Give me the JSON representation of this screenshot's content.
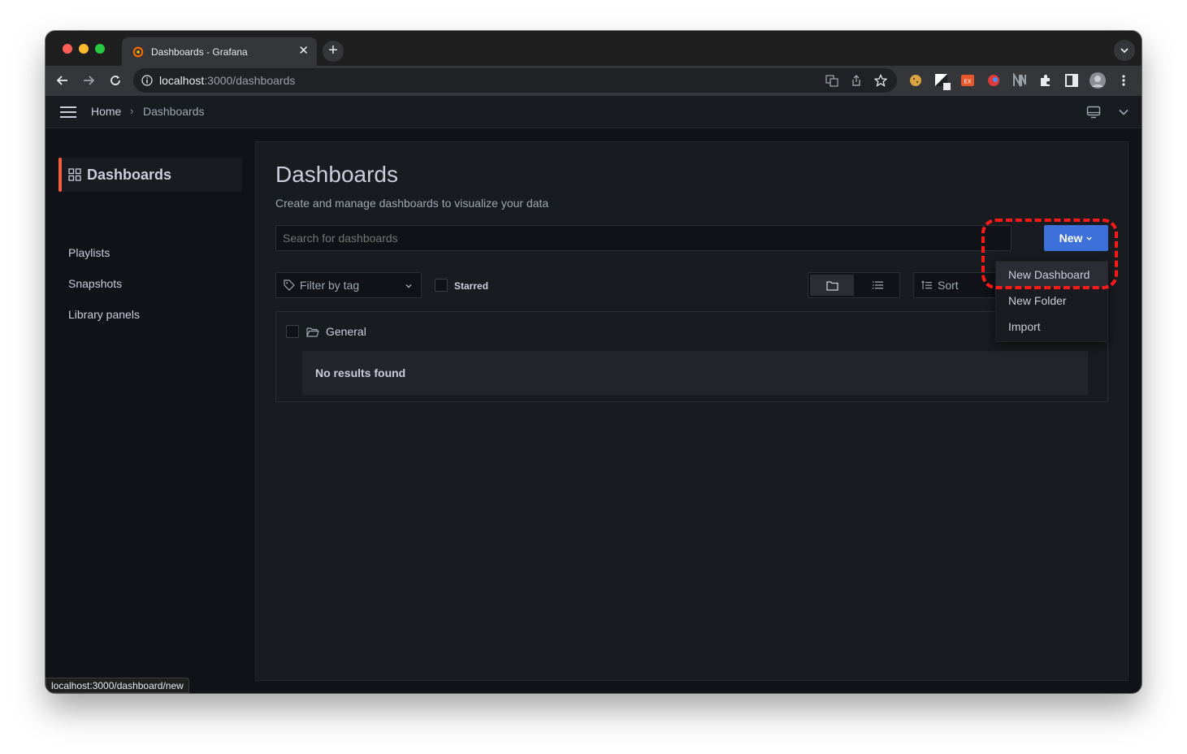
{
  "browser": {
    "tab_title": "Dashboards - Grafana",
    "tab_close": "✕",
    "new_tab": "+",
    "url_host": "localhost",
    "url_path": ":3000/dashboards",
    "status_url": "localhost:3000/dashboard/new"
  },
  "topnav": {
    "breadcrumb_home": "Home",
    "breadcrumb_separator": "›",
    "breadcrumb_current": "Dashboards"
  },
  "sidebar": {
    "active_label": "Dashboards",
    "items": [
      {
        "label": "Playlists"
      },
      {
        "label": "Snapshots"
      },
      {
        "label": "Library panels"
      }
    ]
  },
  "main": {
    "title": "Dashboards",
    "subtitle": "Create and manage dashboards to visualize your data",
    "search_placeholder": "Search for dashboards",
    "new_button": "New",
    "filter_tag_placeholder": "Filter by tag",
    "starred_label": "Starred",
    "sort_label": "Sort",
    "folder_name": "General",
    "empty_message": "No results found"
  },
  "new_menu": {
    "items": [
      {
        "label": "New Dashboard"
      },
      {
        "label": "New Folder"
      },
      {
        "label": "Import"
      }
    ]
  },
  "colors": {
    "accent_blue": "#3d71d9",
    "active_orange": "#f55f3e",
    "highlight_red": "#ff1a1a"
  }
}
